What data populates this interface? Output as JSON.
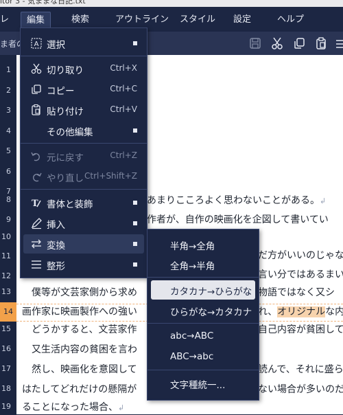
{
  "window": {
    "title": "itor 3 - 気ままな日記.txt"
  },
  "menubar": {
    "items": [
      "レ",
      "編集",
      "検索",
      "アウトライン",
      "スタイル",
      "設定",
      "ヘルプ"
    ]
  },
  "toolbar": {
    "doc_tab": "ま者の"
  },
  "icons": {
    "save": "save-icon",
    "cut": "scissors-icon",
    "copy": "copy-icon",
    "paste": "paste-icon",
    "overflow": "overflow-icon"
  },
  "gutter": {
    "line_numbers": [
      "1",
      "2",
      "3",
      "4",
      "5",
      "6",
      "7",
      "8",
      "9",
      "10",
      "11",
      "12",
      "13",
      "14",
      "15",
      "16",
      "17",
      "18",
      "19"
    ],
    "current_line": "14"
  },
  "editor": {
    "lines": [
      {
        "text": "あまりこころよく思わないことがある。",
        "ret": "↲"
      },
      {
        "text": "作者が、自作の映画化を企図して書いてい",
        "ret": ""
      },
      {
        "text": "",
        "ret": ""
      },
      {
        "text": "だ方がいいのじゃな",
        "ret": ""
      },
      {
        "text": "言い分ではあるまい",
        "ret": ""
      },
      {
        "text": "　僕等が文芸家側から求め",
        "text2": "物語ではなく又シ",
        "ret": ""
      },
      {
        "text": "画作家に映画製作への強い",
        "text2": "れ、",
        "selected": "オリジナル",
        "text3": "な内",
        "ret": ""
      },
      {
        "text": "　どうかすると、文芸家作",
        "text2": "自己内容が貧困して",
        "ret": ""
      },
      {
        "text": "　又生活内容の貧困を言わ",
        "ret": ""
      },
      {
        "text": "　然し、映画化を意図して",
        "text2": "読んで、それに盛ら",
        "ret": ""
      },
      {
        "text": "はたしてどれだけの懸隔が",
        "text2": "ない場合が多いのだ",
        "ret": ""
      },
      {
        "text": "ることになった場合、",
        "ret": "↲"
      }
    ]
  },
  "edit_menu": {
    "items": [
      {
        "label": "選択",
        "shortcut": "",
        "submenu": true
      },
      {
        "label": "切り取り",
        "shortcut": "Ctrl+X"
      },
      {
        "label": "コピー",
        "shortcut": "Ctrl+C"
      },
      {
        "label": "貼り付け",
        "shortcut": "Ctrl+V"
      },
      {
        "label": "その他編集",
        "shortcut": "",
        "submenu": true
      },
      {
        "label": "元に戻す",
        "shortcut": "Ctrl+Z",
        "disabled": true
      },
      {
        "label": "やり直し",
        "shortcut": "Ctrl+Shift+Z",
        "disabled": true
      },
      {
        "label": "書体と装飾",
        "submenu": true
      },
      {
        "label": "挿入",
        "submenu": true
      },
      {
        "label": "変換",
        "submenu": true,
        "active": true
      },
      {
        "label": "整形",
        "submenu": true
      }
    ]
  },
  "convert_menu": {
    "items": [
      {
        "label": "半角→全角"
      },
      {
        "label": "全角→半角"
      },
      {
        "label": "カタカナ→ひらがな",
        "hover": true
      },
      {
        "label": "ひらがな→カタカナ"
      },
      {
        "label": "abc→ABC"
      },
      {
        "label": "ABC→abc"
      },
      {
        "label": "文字種統一..."
      }
    ]
  },
  "colors": {
    "background": "#1b2540",
    "menu": "#1c2643",
    "highlight_line": "#f2a14a",
    "selection": "#f7d3ad"
  }
}
